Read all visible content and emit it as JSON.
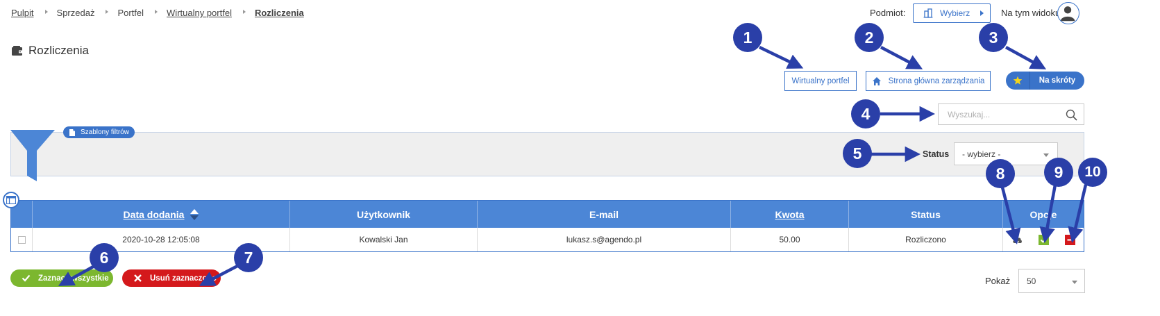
{
  "breadcrumb": {
    "items": [
      "Pulpit",
      "Sprzedaż",
      "Portfel",
      "Wirtualny portfel",
      "Rozliczenia"
    ]
  },
  "header": {
    "podmiot_label": "Podmiot:",
    "podmiot_button": "Wybierz",
    "view_label": "Na tym widoku"
  },
  "page": {
    "title": "Rozliczenia"
  },
  "actions": {
    "wallet_button": "Wirtualny portfel",
    "home_button": "Strona główna zarządzania",
    "shortcuts_button": "Na skróty"
  },
  "search": {
    "placeholder": "Wyszukaj..."
  },
  "filters": {
    "templates_label": "Szablony filtrów",
    "status_label": "Status",
    "status_value": "- wybierz -"
  },
  "table": {
    "columns": [
      "Data dodania",
      "Użytkownik",
      "E-mail",
      "Kwota",
      "Status",
      "Opcje"
    ],
    "rows": [
      {
        "date": "2020-10-28 12:05:08",
        "user": "Kowalski Jan",
        "email": "lukasz.s@agendo.pl",
        "amount": "50.00",
        "status": "Rozliczono"
      }
    ]
  },
  "bottom": {
    "select_all": "Zaznacz wszystkie",
    "delete_selected": "Usuń zaznaczone",
    "show_label": "Pokaż",
    "show_value": "50"
  },
  "callouts": [
    "1",
    "2",
    "3",
    "4",
    "5",
    "6",
    "7",
    "8",
    "9",
    "10"
  ],
  "colors": {
    "primary_blue": "#3a73c9",
    "table_header_blue": "#4c86d6",
    "callout_navy": "#2a3fa8",
    "success_green": "#7cb72f",
    "danger_red": "#d4191c",
    "filter_bg": "#efefef"
  },
  "icons": {
    "title": "wallet-icon",
    "podmiot": "building-icon",
    "home": "home-icon",
    "shortcuts": "star-icon",
    "search": "search-icon",
    "filter": "funnel-icon",
    "templates": "document-icon",
    "columns": "table-layout-icon",
    "download": "cloud-download-icon",
    "settle": "check-icon",
    "delete": "minus-icon",
    "select_all": "check-icon",
    "delete_selected": "close-icon"
  }
}
